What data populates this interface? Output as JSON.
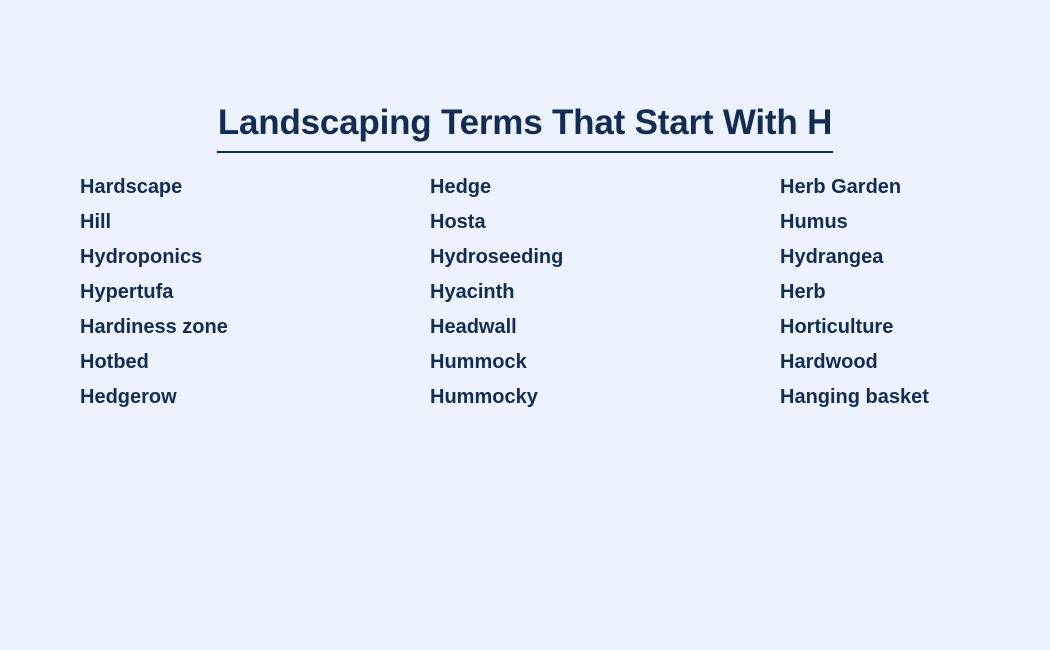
{
  "header": {
    "title": "Landscaping Terms That Start With H"
  },
  "colors": {
    "background": "#ecf3fe",
    "text": "#122c54",
    "underline": "#122c54"
  },
  "columns": [
    {
      "items": [
        "Hardscape",
        "Hill",
        "Hydroponics",
        "Hypertufa",
        "Hardiness zone",
        "Hotbed",
        "Hedgerow"
      ]
    },
    {
      "items": [
        "Hedge",
        "Hosta",
        "Hydroseeding",
        "Hyacinth",
        "Headwall",
        "Hummock",
        "Hummocky"
      ]
    },
    {
      "items": [
        "Herb Garden",
        "Humus",
        "Hydrangea",
        "Herb",
        "Horticulture",
        "Hardwood",
        "Hanging basket"
      ]
    }
  ]
}
